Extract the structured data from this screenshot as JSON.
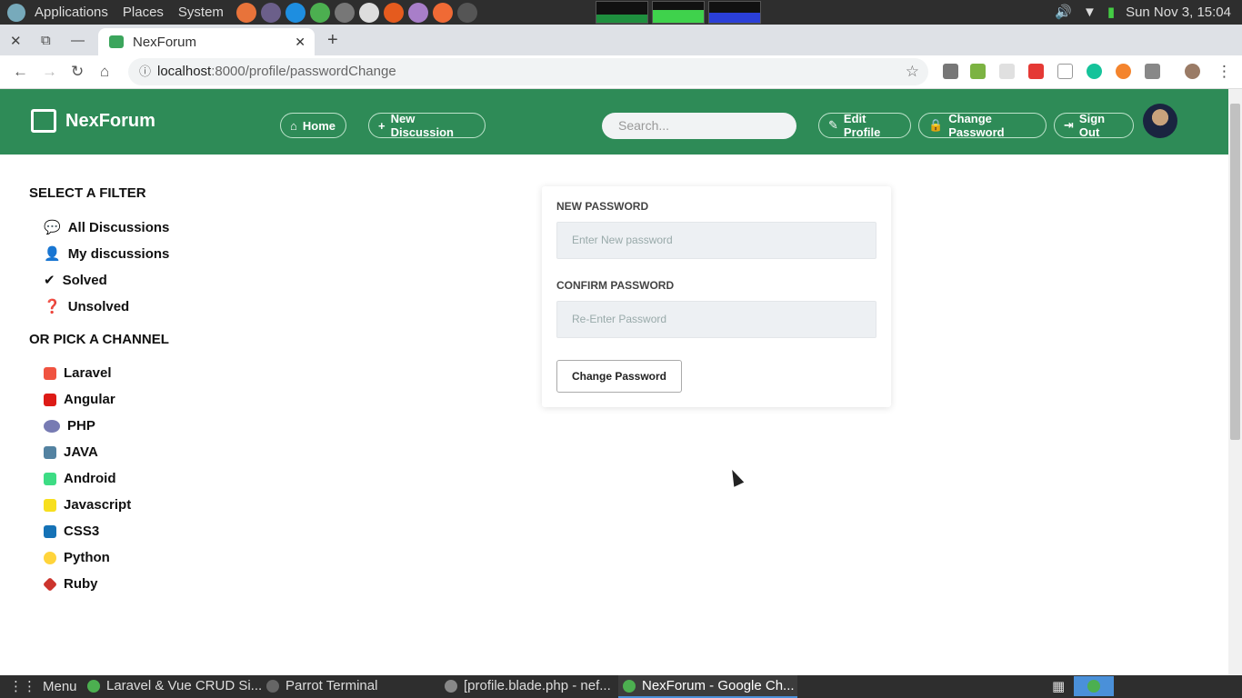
{
  "os": {
    "menus": [
      "Applications",
      "Places",
      "System"
    ],
    "clock": "Sun Nov 3, 15:04"
  },
  "browser": {
    "tab_title": "NexForum",
    "url_host": "localhost",
    "url_rest": ":8000/profile/passwordChange"
  },
  "app": {
    "brand": "NexForum",
    "nav": {
      "home": "Home",
      "new_discussion": "New Discussion",
      "search_placeholder": "Search...",
      "edit_profile": "Edit Profile",
      "change_password": "Change Password",
      "sign_out": "Sign Out"
    }
  },
  "sidebar": {
    "filter_heading": "SELECT A FILTER",
    "filters": [
      "All Discussions",
      "My discussions",
      "Solved",
      "Unsolved"
    ],
    "channel_heading": "OR PICK A CHANNEL",
    "channels": [
      "Laravel",
      "Angular",
      "PHP",
      "JAVA",
      "Android",
      "Javascript",
      "CSS3",
      "Python",
      "Ruby"
    ]
  },
  "form": {
    "new_password_label": "NEW PASSWORD",
    "new_password_placeholder": "Enter New password",
    "confirm_label": "CONFIRM PASSWORD",
    "confirm_placeholder": "Re-Enter Password",
    "submit": "Change Password"
  },
  "taskbar": {
    "menu": "Menu",
    "items": [
      "Laravel & Vue CRUD Si...",
      "Parrot Terminal",
      "[profile.blade.php - nef...",
      "NexForum - Google Ch..."
    ]
  },
  "colors": {
    "header_green": "#2e8b57"
  }
}
